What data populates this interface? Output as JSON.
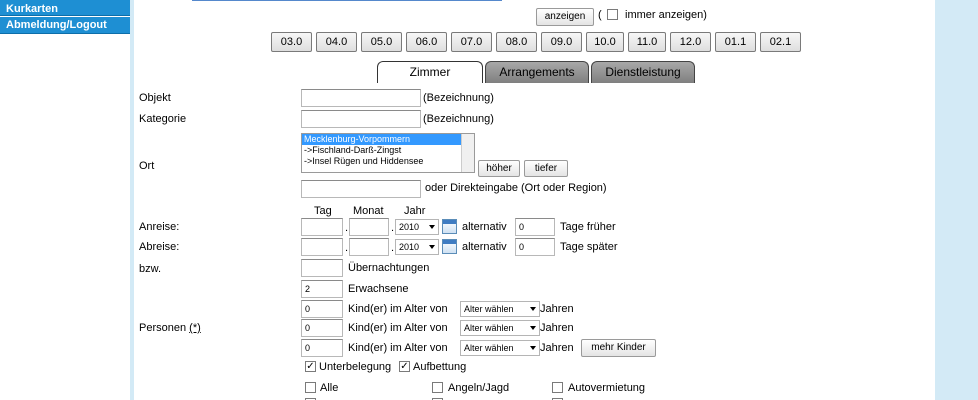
{
  "sidebar": {
    "items": [
      {
        "label": "Kurkarten"
      },
      {
        "label": "Abmeldung/Logout"
      }
    ]
  },
  "top": {
    "show_label": "anzeigen",
    "paren_open": "(",
    "always_show_label": "immer anzeigen)"
  },
  "date_buttons": [
    "03.0",
    "04.0",
    "05.0",
    "06.0",
    "07.0",
    "08.0",
    "09.0",
    "10.0",
    "11.0",
    "12.0",
    "01.1",
    "02.1"
  ],
  "tabs": [
    {
      "label": "Zimmer",
      "active": true
    },
    {
      "label": "Arrangements",
      "active": false
    },
    {
      "label": "Dienstleistung",
      "active": false
    }
  ],
  "form": {
    "objekt": {
      "label": "Objekt",
      "hint": "(Bezeichnung)",
      "value": ""
    },
    "kategorie": {
      "label": "Kategorie",
      "hint": "(Bezeichnung)",
      "value": ""
    },
    "ort": {
      "label": "Ort",
      "options": [
        "Mecklenburg-Vorpommern",
        "->Fischland-Darß-Zingst",
        "->Insel Rügen und Hiddensee"
      ],
      "selected_index": 0,
      "higher_label": "höher",
      "lower_label": "tiefer",
      "direct_hint": "oder Direkteingabe (Ort oder Region)",
      "direct_value": ""
    },
    "date_headers": {
      "tag": "Tag",
      "monat": "Monat",
      "jahr": "Jahr"
    },
    "anreise": {
      "label": "Anreise:",
      "year": "2010",
      "alt_label": "alternativ",
      "alt_value": "0",
      "suffix": "Tage früher",
      "dot": "."
    },
    "abreise": {
      "label": "Abreise:",
      "year": "2010",
      "alt_label": "alternativ",
      "alt_value": "0",
      "suffix": "Tage später",
      "dot": "."
    },
    "bzw": {
      "label": "bzw.",
      "nights_label": "Übernachtungen",
      "value": ""
    },
    "personen": {
      "label": "Personen",
      "star": "(*)",
      "adults_value": "2",
      "adults_label": "Erwachsene",
      "children": [
        {
          "value": "0",
          "label": "Kind(er) im Alter von",
          "select": "Alter wählen",
          "suffix": "Jahren"
        },
        {
          "value": "0",
          "label": "Kind(er) im Alter von",
          "select": "Alter wählen",
          "suffix": "Jahren"
        },
        {
          "value": "0",
          "label": "Kind(er) im Alter von",
          "select": "Alter wählen",
          "suffix": "Jahren"
        }
      ],
      "more_children_label": "mehr Kinder"
    },
    "options": {
      "unterbelegung": {
        "label": "Unterbelegung",
        "checked": true
      },
      "aufbettung": {
        "label": "Aufbettung",
        "checked": true
      }
    },
    "categories": [
      {
        "label": "Alle",
        "checked": false
      },
      {
        "label": "Angeln/Jagd",
        "checked": false
      },
      {
        "label": "Autovermietung",
        "checked": false
      }
    ]
  },
  "colors": {
    "sidebar": "#1e8fd3",
    "bg_right": "#d3eaf6",
    "tab_inactive": "#8f8f8f"
  }
}
